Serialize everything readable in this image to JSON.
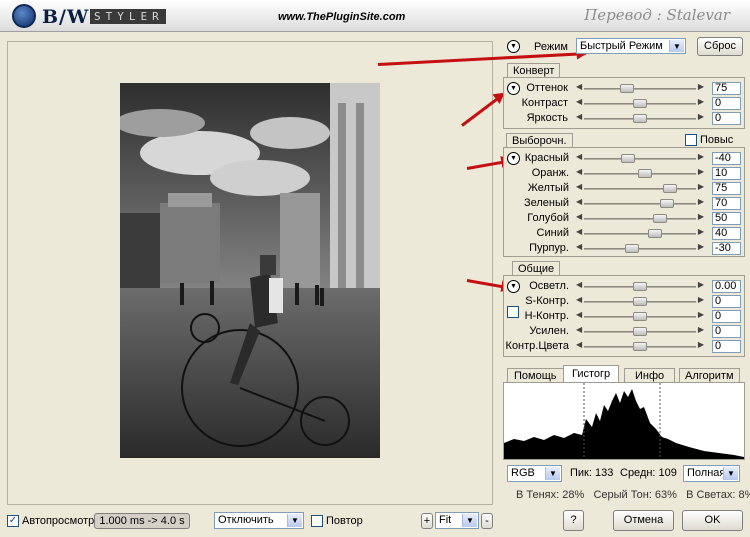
{
  "header": {
    "logo_text": "B/W",
    "logo_styler": "STYLER",
    "site": "www.ThePluginSite.com",
    "translator": "Перевод : Stalevar"
  },
  "mode": {
    "label": "Режим",
    "value": "Быстрый Режим",
    "reset": "Сброс"
  },
  "convert": {
    "tab": "Конверт",
    "rows": [
      {
        "label": "Оттенок",
        "value": "75",
        "level": 0.37
      },
      {
        "label": "Контраст",
        "value": "0",
        "level": 0.5
      },
      {
        "label": "Яркость",
        "value": "0",
        "level": 0.5
      }
    ]
  },
  "selective": {
    "tab": "Выборочн.",
    "increase_label": "Повыс",
    "rows": [
      {
        "label": "Красный",
        "value": "-40",
        "level": 0.38
      },
      {
        "label": "Оранж.",
        "value": "10",
        "level": 0.55
      },
      {
        "label": "Желтый",
        "value": "75",
        "level": 0.81
      },
      {
        "label": "Зеленый",
        "value": "70",
        "level": 0.78
      },
      {
        "label": "Голубой",
        "value": "50",
        "level": 0.7
      },
      {
        "label": "Синий",
        "value": "40",
        "level": 0.65
      },
      {
        "label": "Пурпур.",
        "value": "-30",
        "level": 0.42
      }
    ]
  },
  "general": {
    "tab": "Общие",
    "rows": [
      {
        "label": "Осветл.",
        "value": "0.00",
        "level": 0.5
      },
      {
        "label": "S-Контр.",
        "value": "0",
        "level": 0.5
      },
      {
        "label": "Н-Контр.",
        "value": "0",
        "level": 0.5
      },
      {
        "label": "Усилен.",
        "value": "0",
        "level": 0.5
      },
      {
        "label": "Контр.Цвета",
        "value": "0",
        "level": 0.5
      }
    ]
  },
  "bottom_tabs": [
    "Помощь",
    "Гистогр",
    "Инфо",
    "Алгоритм"
  ],
  "histogram": {
    "channel": "RGB",
    "peak": "Пик: 133",
    "mean": "Средн: 109",
    "range": "Полная",
    "stats": "В Тенях: 28%   Серый Тон: 63%   В Светах: 8%"
  },
  "footer": {
    "autopreview": "Автопросмотр",
    "timing": "1.000 ms -> 4.0 s",
    "disable": "Отключить",
    "repeat": "Повтор",
    "zoom": "Fit",
    "plus": "+",
    "minus": "-",
    "help": "?",
    "cancel": "Отмена",
    "ok": "OK"
  },
  "colors": {
    "arrow": "#c41010",
    "combo_border": "#7f9db9",
    "accent": "#1a3e8c"
  }
}
